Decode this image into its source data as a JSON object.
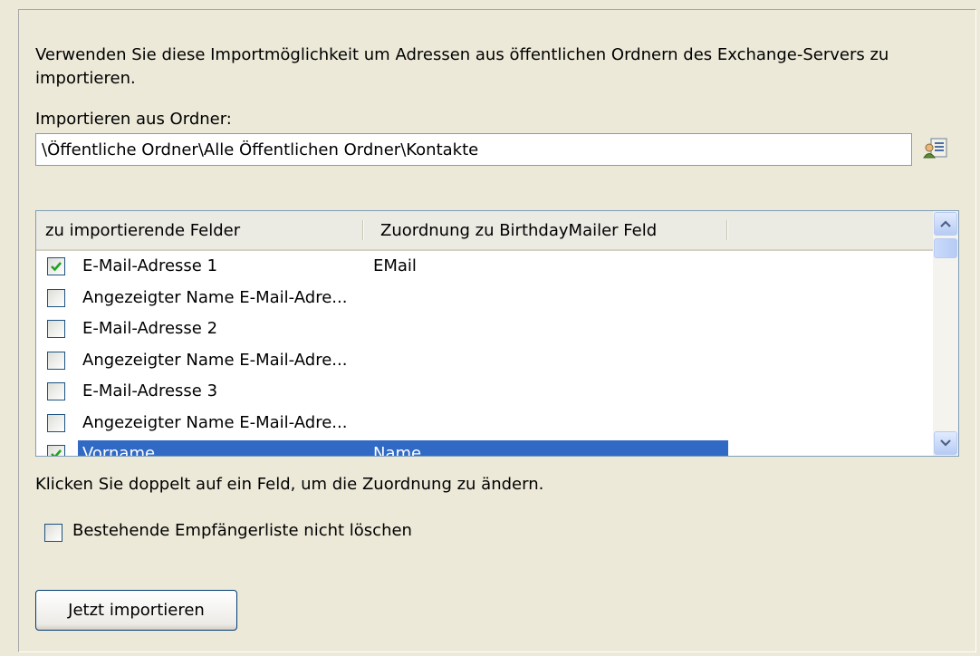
{
  "description": "Verwenden Sie diese Importmöglichkeit um Adressen aus öffentlichen Ordnern des Exchange-Servers zu importieren.",
  "folder": {
    "label": "Importieren aus Ordner:",
    "value": "\\Öffentliche Ordner\\Alle Öffentlichen Ordner\\Kontakte",
    "browse_icon": "address-book-icon"
  },
  "field_list": {
    "columns": [
      "zu importierende Felder",
      "Zuordnung zu BirthdayMailer Feld"
    ],
    "rows": [
      {
        "field": "E-Mail-Adresse 1",
        "mapping": "EMail",
        "checked": true,
        "selected": false
      },
      {
        "field": "Angezeigter Name E-Mail-Adre...",
        "mapping": "",
        "checked": false,
        "selected": false
      },
      {
        "field": "E-Mail-Adresse 2",
        "mapping": "",
        "checked": false,
        "selected": false
      },
      {
        "field": "Angezeigter Name E-Mail-Adre...",
        "mapping": "",
        "checked": false,
        "selected": false
      },
      {
        "field": "E-Mail-Adresse 3",
        "mapping": "",
        "checked": false,
        "selected": false
      },
      {
        "field": "Angezeigter Name E-Mail-Adre...",
        "mapping": "",
        "checked": false,
        "selected": false
      },
      {
        "field": "Vorname",
        "mapping": "Name",
        "checked": true,
        "selected": true
      }
    ]
  },
  "hint": "Klicken Sie doppelt auf ein Feld, um die Zuordnung zu ändern.",
  "keep_list": {
    "label": "Bestehende Empfängerliste nicht löschen",
    "checked": false
  },
  "import_button": "Jetzt importieren",
  "colors": {
    "selection": "#316AC5",
    "check": "#21A121",
    "background": "#ECE9D8"
  }
}
